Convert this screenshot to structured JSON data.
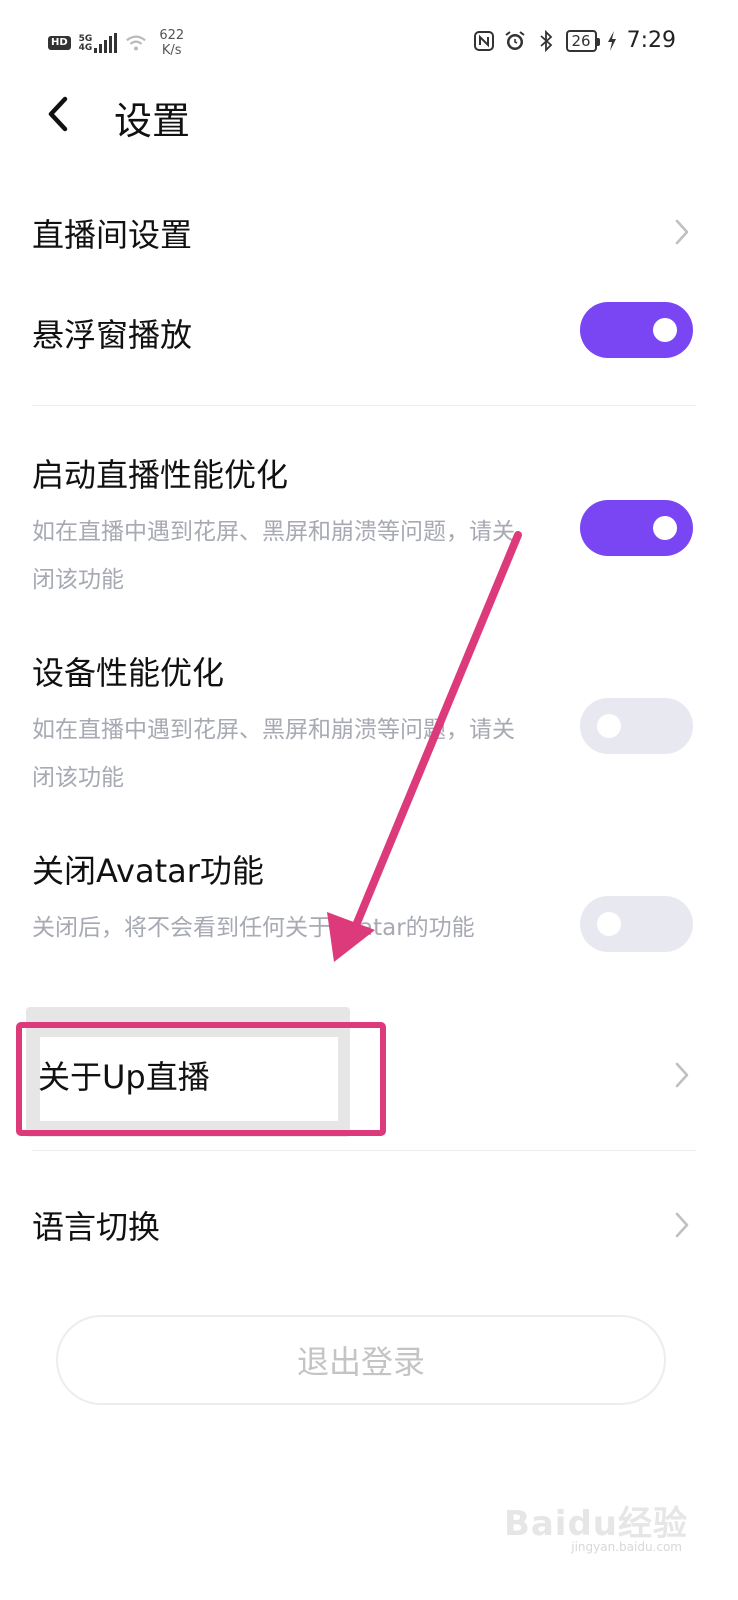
{
  "status_bar": {
    "hd": "HD",
    "signal_type": "5G",
    "signal_sub": "4G",
    "net_speed_value": "622",
    "net_speed_unit": "K/s",
    "battery": "26",
    "time": "7:29"
  },
  "header": {
    "title": "设置",
    "back_icon": "chevron-left-icon"
  },
  "settings": {
    "live_room": {
      "label": "直播间设置"
    },
    "float_window": {
      "label": "悬浮窗播放",
      "enabled": true
    },
    "live_perf": {
      "label": "启动直播性能优化",
      "desc": "如在直播中遇到花屏、黑屏和崩溃等问题，请关闭该功能",
      "enabled": true
    },
    "device_perf": {
      "label": "设备性能优化",
      "desc": "如在直播中遇到花屏、黑屏和崩溃等问题，请关闭该功能",
      "enabled": false
    },
    "avatar": {
      "label": "关闭Avatar功能",
      "desc": "关闭后，将不会看到任何关于Avatar的功能",
      "enabled": false
    },
    "about": {
      "label": "关于Up直播"
    },
    "language": {
      "label": "语言切换"
    }
  },
  "logout": {
    "label": "退出登录"
  },
  "watermark": {
    "text": "Baidu经验",
    "sub": "jingyan.baidu.com"
  },
  "colors": {
    "toggle_on": "#7a45f3",
    "toggle_off": "#e8e8f1",
    "annotation": "#dc3a7a"
  }
}
